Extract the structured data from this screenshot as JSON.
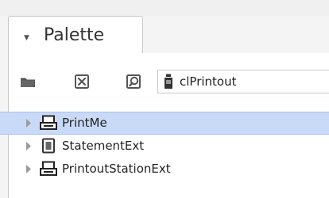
{
  "tab": {
    "title": "Palette",
    "collapse_icon": "chevron-down-icon"
  },
  "toolbar": {
    "open_icon": "folder-icon",
    "close_icon": "close-icon",
    "search_icon": "search-icon",
    "module_icon": "module-jar-icon",
    "module_value": "clPrintout"
  },
  "tree": {
    "items": [
      {
        "label": "PrintMe",
        "icon": "printer-icon",
        "selected": true
      },
      {
        "label": "StatementExt",
        "icon": "document-icon",
        "selected": false
      },
      {
        "label": "PrintoutStationExt",
        "icon": "printer-icon",
        "selected": false
      }
    ]
  }
}
